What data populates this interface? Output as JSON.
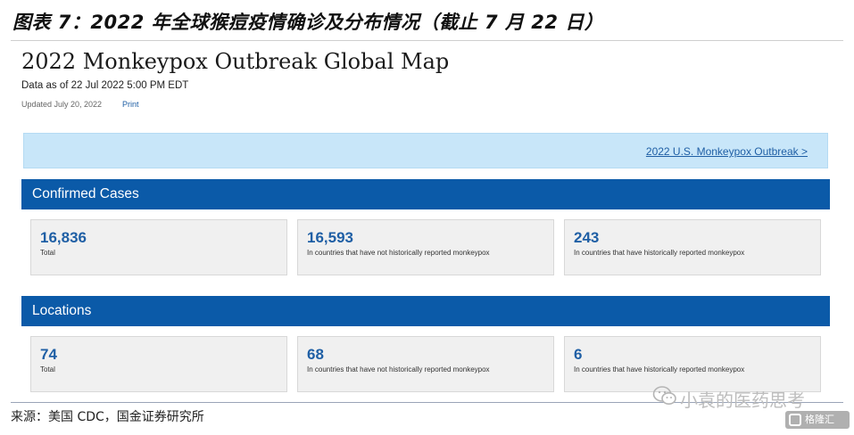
{
  "report": {
    "figure_title": "图表 7：2022 年全球猴痘疫情确诊及分布情况（截止 7 月 22 日）",
    "source": "来源：美国 CDC，国金证券研究所"
  },
  "page": {
    "heading": "2022 Monkeypox Outbreak Global Map",
    "data_date": "Data as of 22 Jul 2022 5:00 PM EDT",
    "updated": "Updated July 20, 2022",
    "print_label": "Print",
    "us_outbreak_link": "2022 U.S. Monkeypox Outbreak >"
  },
  "confirmed_cases": {
    "title": "Confirmed Cases",
    "cards": [
      {
        "value": "16,836",
        "caption": "Total"
      },
      {
        "value": "16,593",
        "caption": "In countries that have not historically reported monkeypox"
      },
      {
        "value": "243",
        "caption": "In countries that have historically reported monkeypox"
      }
    ]
  },
  "locations": {
    "title": "Locations",
    "cards": [
      {
        "value": "74",
        "caption": "Total"
      },
      {
        "value": "68",
        "caption": "In countries that have not historically reported monkeypox"
      },
      {
        "value": "6",
        "caption": "In countries that have historically reported monkeypox"
      }
    ]
  },
  "watermark": {
    "account": "小袁的医药思考",
    "logo_text": "格隆汇",
    "icon": "wechat-icon"
  },
  "colors": {
    "section_bar": "#0b5aa8",
    "stat_value": "#1f5fa5",
    "banner": "#c8e6f9",
    "card": "#f0f0f0"
  }
}
